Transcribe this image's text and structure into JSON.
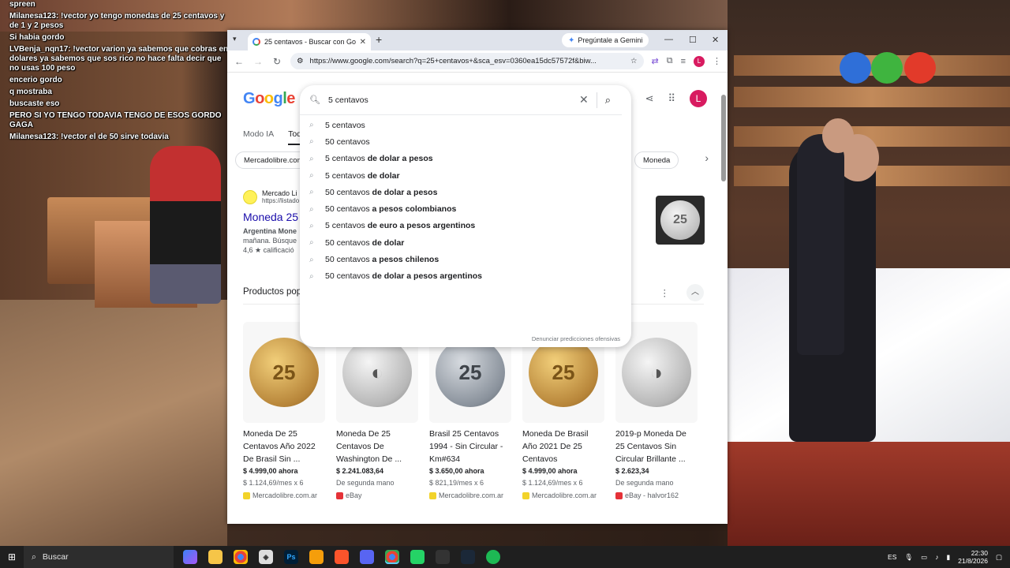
{
  "chat": [
    {
      "user": "",
      "text": "spreen"
    },
    {
      "user": "Milanesa123:",
      "text": "!vector yo tengo monedas de 25 centavos y de 1 y 2 pesos"
    },
    {
      "user": "",
      "text": "Si habia gordo"
    },
    {
      "user": "LVBenja_nqn17:",
      "text": "!vector varion ya sabemos que cobras en dolares ya sabemos que sos rico no hace falta decir que no usas 100 peso"
    },
    {
      "user": "",
      "text": "encerio gordo"
    },
    {
      "user": "",
      "text": "q mostraba"
    },
    {
      "user": "",
      "text": "buscaste eso"
    },
    {
      "user": "",
      "text": "PERO SI YO TENGO TODAVIA TENGO DE ESOS GORDO GAGA"
    },
    {
      "user": "Milanesa123:",
      "text": "!vector el de 50 sirve todavia"
    }
  ],
  "browser": {
    "tab_title": "25 centavos - Buscar con Google",
    "gemini_label": "Pregúntale a Gemini",
    "url": "https://www.google.com/search?q=25+centavos+&sca_esv=0360ea15dc57572f&biw...",
    "profile_letter": "L"
  },
  "google": {
    "logo": [
      "G",
      "o",
      "o",
      "g",
      "l",
      "e"
    ],
    "modes": [
      "Modo IA",
      "Todo"
    ],
    "chips": [
      "Mercadolibre.com",
      "Moneda"
    ],
    "search_value": "5 centavos",
    "suggestions": [
      {
        "prefix": "5",
        "rest": " centavos",
        "bold": ""
      },
      {
        "prefix": "5",
        "rest": "0 centavos",
        "bold": ""
      },
      {
        "prefix": "5 centavos",
        "rest": "",
        "bold": " de dolar a pesos"
      },
      {
        "prefix": "5 centavos",
        "rest": "",
        "bold": " de dolar"
      },
      {
        "prefix": "50 centavos",
        "rest": "",
        "bold": " de dolar a pesos"
      },
      {
        "prefix": "50 centavos",
        "rest": "",
        "bold": " a pesos colombianos"
      },
      {
        "prefix": "5 centavos",
        "rest": "",
        "bold": " de euro a pesos argentinos"
      },
      {
        "prefix": "50 centavos",
        "rest": "",
        "bold": " de dolar"
      },
      {
        "prefix": "50 centavos",
        "rest": "",
        "bold": " a pesos chilenos"
      },
      {
        "prefix": "50 centavos",
        "rest": "",
        "bold": " de dolar a pesos argentinos"
      }
    ],
    "report_label": "Denunciar predicciones ofensivas",
    "result": {
      "site_name": "Mercado Li",
      "site_url": "https://listado",
      "title": "Moneda 25",
      "snippet1": "Argentina Mone",
      "snippet2": "mañana. Búsque",
      "rating": "4,6 ★ calificació",
      "thumb_text": "25"
    },
    "products_title": "Productos populares",
    "products": [
      {
        "name": "Moneda De 25 Centavos Año 2022 De Brasil Sin ...",
        "price": "$ 4.999,00 ahora",
        "sub": "$ 1.124,69/mes x 6",
        "seller": "Mercadolibre.com.ar",
        "coin": "25",
        "style": "gold",
        "seller_color": "#f2d32a"
      },
      {
        "name": "Moneda De 25 Centavos De Washington De ...",
        "price": "$ 2.241.083,64",
        "sub": "De segunda mano",
        "seller": "eBay",
        "coin": "◐",
        "style": "silver",
        "seller_color": "#e53238"
      },
      {
        "name": "Brasil 25 Centavos 1994 - Sin Circular - Km#634",
        "price": "$ 3.650,00 ahora",
        "sub": "$ 821,19/mes x 6",
        "seller": "Mercadolibre.com.ar",
        "coin": "25",
        "style": "steel",
        "seller_color": "#f2d32a"
      },
      {
        "name": "Moneda De Brasil Año 2021 De 25 Centavos",
        "price": "$ 4.999,00 ahora",
        "sub": "$ 1.124,69/mes x 6",
        "seller": "Mercadolibre.com.ar",
        "coin": "25",
        "style": "gold",
        "seller_color": "#f2d32a"
      },
      {
        "name": "2019-p Moneda De 25 Centavos Sin Circular Brillante ...",
        "price": "$ 2.623,34",
        "sub": "De segunda mano",
        "seller": "eBay - halvor162",
        "coin": "◑",
        "style": "silver",
        "seller_color": "#e53238"
      }
    ]
  },
  "taskbar": {
    "search_label": "Buscar",
    "lang": "ES",
    "time": "22:30",
    "date": "21/8/2026"
  }
}
